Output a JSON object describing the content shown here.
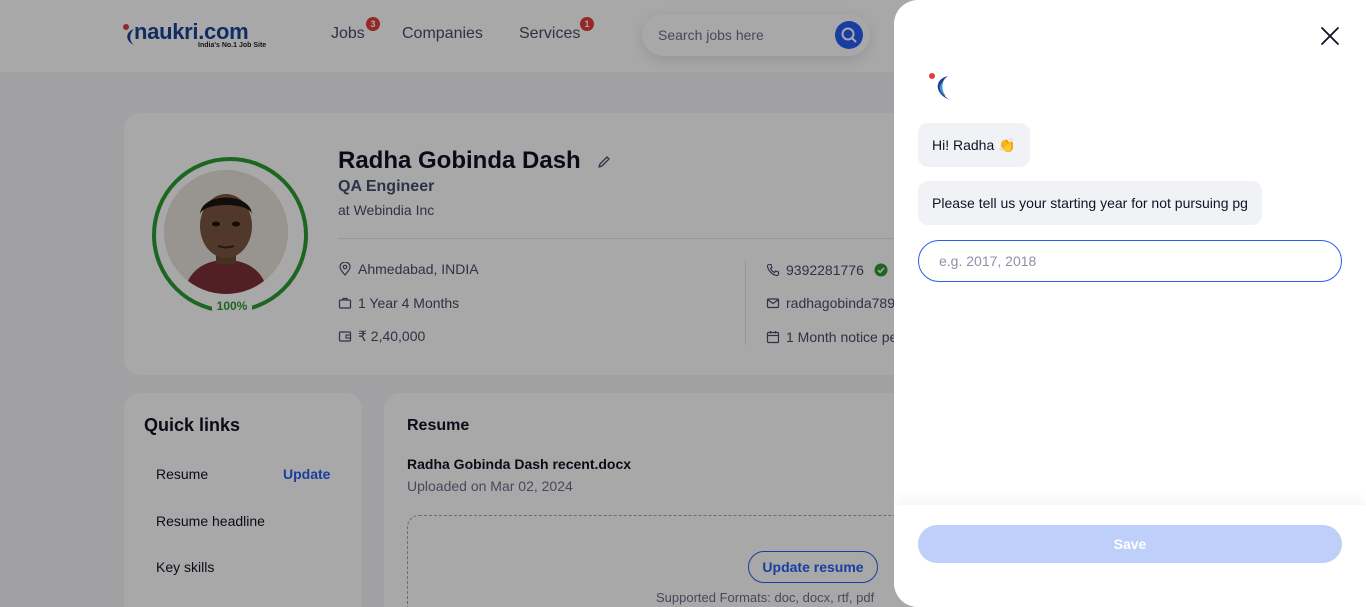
{
  "header": {
    "logo_text": "naukri.com",
    "logo_tagline": "India's No.1 Job Site",
    "nav": [
      {
        "label": "Jobs",
        "badge": "3"
      },
      {
        "label": "Companies",
        "badge": ""
      },
      {
        "label": "Services",
        "badge": "1"
      }
    ],
    "search_placeholder": "Search jobs here",
    "search_icon": "search-icon"
  },
  "profile": {
    "name": "Radha Gobinda Dash",
    "title": "QA Engineer",
    "company": "at Webindia Inc",
    "completion": "100%",
    "location": "Ahmedabad, INDIA",
    "experience": "1 Year 4 Months",
    "salary": "₹ 2,40,000",
    "phone": "9392281776",
    "email": "radhagobinda789",
    "notice": "1 Month notice pe",
    "ring_color": "#2d9b34"
  },
  "quick_links": {
    "title": "Quick links",
    "items": [
      "Resume",
      "Resume headline",
      "Key skills"
    ],
    "update_label": "Update"
  },
  "resume": {
    "title": "Resume",
    "file_name": "Radha Gobinda Dash recent.docx",
    "uploaded": "Uploaded on Mar 02, 2024",
    "update_button": "Update resume",
    "formats": "Supported Formats: doc, docx, rtf, pdf"
  },
  "chatbot": {
    "greeting": "Hi! Radha 👏",
    "question": "Please tell us your starting year for not pursuing pg",
    "answer_placeholder": "e.g. 2017, 2018",
    "answer_value": "",
    "save_label": "Save",
    "accent": "#275df5"
  }
}
